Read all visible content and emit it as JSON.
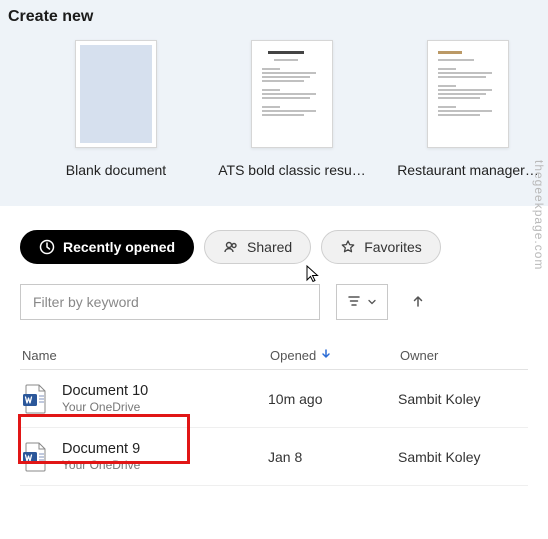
{
  "create": {
    "title": "Create new",
    "templates": [
      {
        "label": "Blank document",
        "kind": "blank"
      },
      {
        "label": "ATS bold classic resu…",
        "kind": "resume"
      },
      {
        "label": "Restaurant manager…",
        "kind": "resume2"
      }
    ]
  },
  "tabs": [
    {
      "label": "Recently opened",
      "icon": "clock-icon",
      "active": true
    },
    {
      "label": "Shared",
      "icon": "people-icon",
      "active": false
    },
    {
      "label": "Favorites",
      "icon": "star-icon",
      "active": false
    }
  ],
  "filter": {
    "placeholder": "Filter by keyword"
  },
  "table": {
    "columns": {
      "name": "Name",
      "opened": "Opened",
      "owner": "Owner"
    },
    "rows": [
      {
        "name": "Document 10",
        "location": "Your OneDrive",
        "opened": "10m ago",
        "owner": "Sambit Koley"
      },
      {
        "name": "Document 9",
        "location": "Your OneDrive",
        "opened": "Jan 8",
        "owner": "Sambit Koley"
      }
    ]
  },
  "watermark": "thegeekpage.com"
}
